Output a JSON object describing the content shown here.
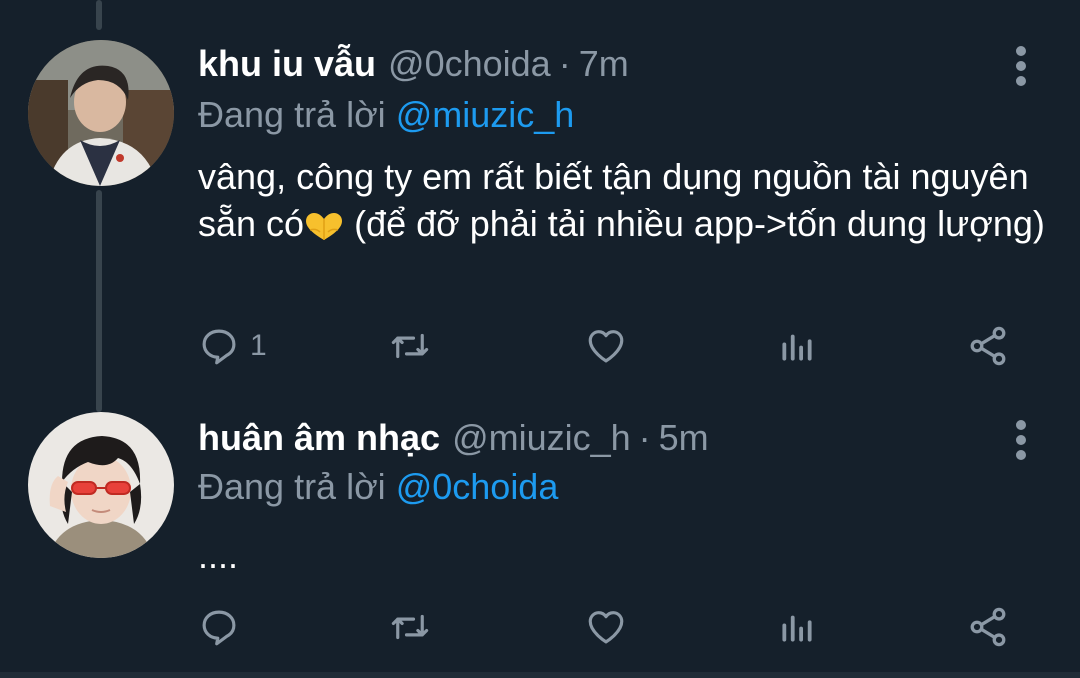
{
  "tweets": [
    {
      "display_name": "khu iu vẫu",
      "handle": "@0choida",
      "separator": "·",
      "time": "7m",
      "reply_prefix": "Đang trả lời",
      "reply_target": "@miuzic_h",
      "text_before_emoji": "vâng, công ty em rất biết tận dụng nguồn tài nguyên sẵn có",
      "emoji": "heart-hands-emoji",
      "text_after_emoji": " (để đỡ phải tải nhiều app->tốn dung lượng)",
      "reply_count": "1",
      "icons": [
        "reply-icon",
        "retweet-icon",
        "like-icon",
        "analytics-icon",
        "share-icon"
      ]
    },
    {
      "display_name": "huân âm nhạc",
      "handle": "@miuzic_h",
      "separator": "·",
      "time": "5m",
      "reply_prefix": "Đang trả lời",
      "reply_target": "@0choida",
      "text": "....",
      "reply_count": "",
      "icons": [
        "reply-icon",
        "retweet-icon",
        "like-icon",
        "analytics-icon",
        "share-icon"
      ]
    }
  ],
  "colors": {
    "background": "#15202b",
    "primary_text": "#ffffff",
    "secondary_text": "#8b98a5",
    "accent": "#1d9bf0",
    "thread_line": "#38444d"
  }
}
